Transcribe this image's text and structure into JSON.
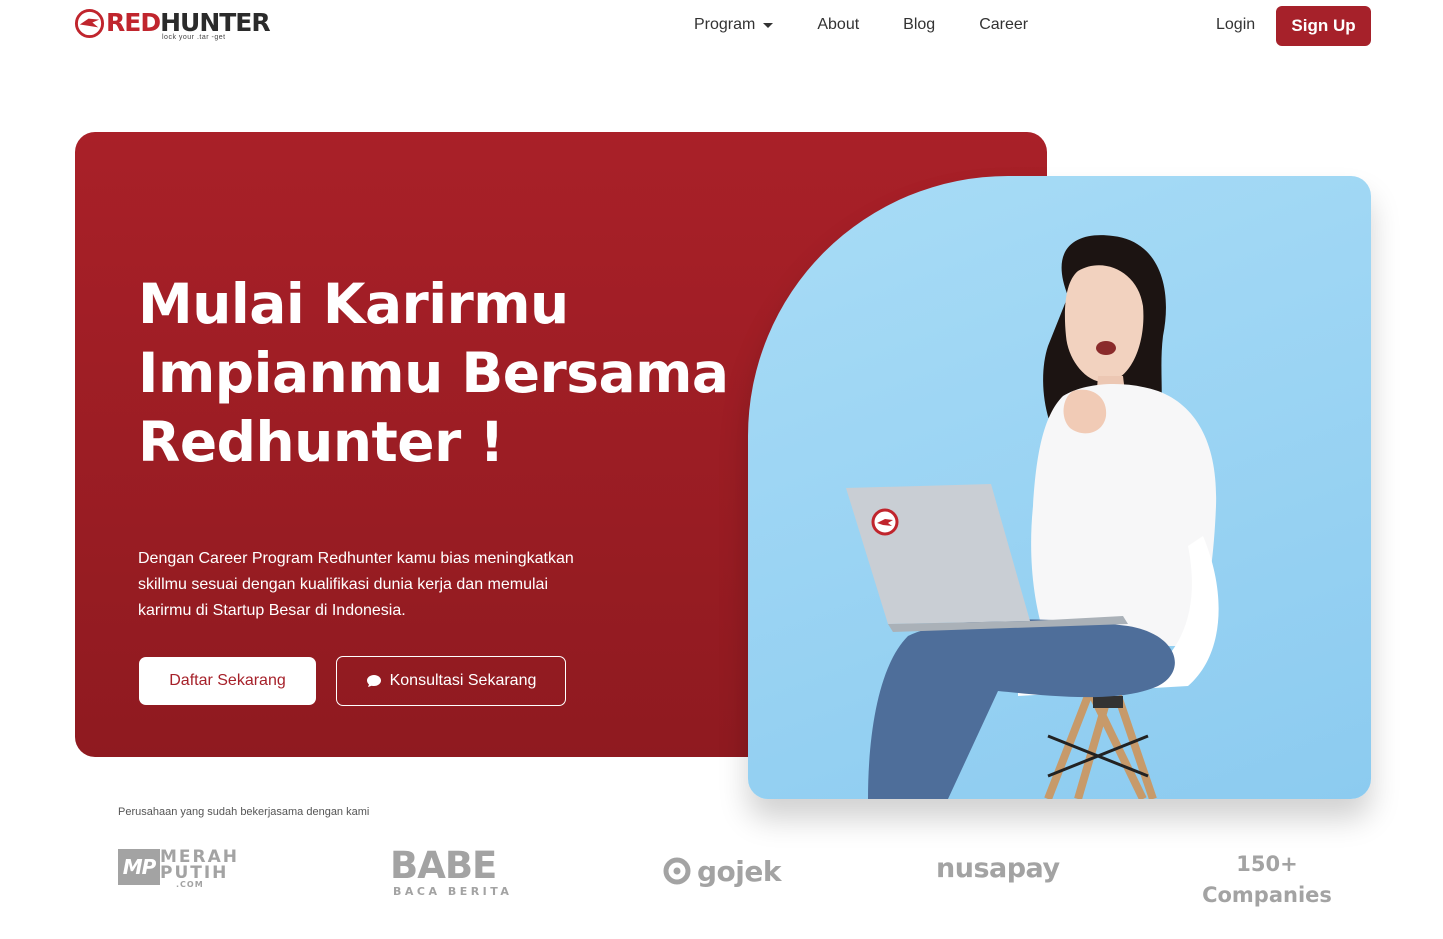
{
  "brand": {
    "name_red": "RED",
    "name_dark": "HUNTER",
    "tagline": "lock your .tar -get",
    "colors": {
      "primary": "#a6212a",
      "hero_bg": "#a92028",
      "photo_bg": "#a8dcf6"
    }
  },
  "nav": {
    "items": [
      {
        "label": "Program",
        "has_dropdown": true
      },
      {
        "label": "About"
      },
      {
        "label": "Blog"
      },
      {
        "label": "Career"
      }
    ],
    "login_label": "Login",
    "signup_label": "Sign Up"
  },
  "hero": {
    "title_line1": "Mulai Karirmu",
    "title_line2": "Impianmu Bersama",
    "title_line3": "Redhunter !",
    "desc_line1": "Dengan Career Program Redhunter kamu bias meningkatkan",
    "desc_line2": "skillmu sesuai dengan kualifikasi dunia kerja dan memulai",
    "desc_line3": "karirmu di Startup Besar di Indonesia.",
    "primary_button": "Daftar Sekarang",
    "secondary_button": "Konsultasi Sekarang",
    "secondary_icon": "chat-bubble-icon"
  },
  "partners": {
    "label": "Perusahaan yang sudah bekerjasama dengan kami",
    "merahputih": {
      "badge": "MP",
      "line1": "MERAH",
      "line2": "PUTIH",
      "line3": ".COM"
    },
    "babe": {
      "line1": "BABE",
      "line2": "BACA BERITA"
    },
    "gojek": {
      "name": "gojek"
    },
    "nusapay": {
      "name": "nusapay"
    },
    "more": {
      "line1": "150+",
      "line2": "Companies"
    }
  }
}
